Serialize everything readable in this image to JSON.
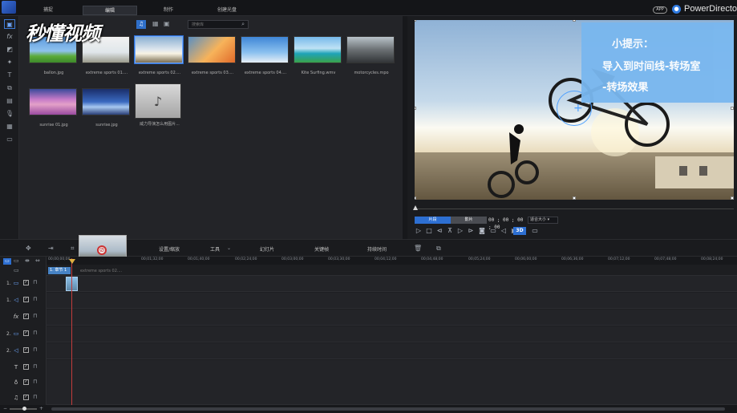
{
  "titlebar": {
    "tabs": [
      {
        "label": "捕捉",
        "active": false
      },
      {
        "label": "编辑",
        "active": true
      },
      {
        "label": "制作",
        "active": false
      },
      {
        "label": "创建光盘",
        "active": false
      }
    ],
    "app_badge": "APP",
    "brand": "PowerDirector"
  },
  "watermark": "秒懂视频",
  "library": {
    "search_placeholder": "搜索库",
    "items": [
      {
        "name": "ballon.jpg",
        "icon": "image"
      },
      {
        "name": "extreme sports 01....",
        "icon": "image"
      },
      {
        "name": "extreme sports 02....",
        "icon": "image",
        "selected": true
      },
      {
        "name": "extreme sports 03....",
        "icon": "image"
      },
      {
        "name": "extreme sports 04....",
        "icon": "image"
      },
      {
        "name": "Kite Surfing.wmv",
        "icon": "video"
      },
      {
        "name": "motorcycles.mpo",
        "icon": "image"
      },
      {
        "name": "sunrise 01.jpg",
        "icon": "image"
      },
      {
        "name": "sunrise.jpg",
        "icon": "image"
      },
      {
        "name": "威力导演怎么用图片...",
        "icon": "music-note-icon"
      }
    ]
  },
  "preview": {
    "tip_lines": [
      "小提示：",
      "导入到时间线-转场室",
      "-转场效果"
    ],
    "mode_clip": "片段",
    "mode_movie": "影片",
    "timecode": "00 ; 00 ; 00 ; 00",
    "zoom": "适合大小",
    "threed": "3D"
  },
  "timeline_toolbar": {
    "fit_crop": "设置/缩放",
    "tools": "工具",
    "slideshow": "幻灯片",
    "keyframe": "关键帧",
    "duration": "持续时间"
  },
  "ruler": {
    "ticks": [
      "00;00;00;00",
      "00;01;32;00",
      "00;01;40;00",
      "00;02;24;00",
      "00;03;00;00",
      "00;03;30;00",
      "00;04;12;00",
      "00;04;48;00",
      "00;05;24;00",
      "00;06;00;00",
      "00;06;36;00",
      "00;07;12;00",
      "00;07;48;00",
      "00;08;24;00"
    ]
  },
  "timeline": {
    "chapter_label": "1. 章节 1",
    "clip_label": "extreme sports 02....",
    "tracks": [
      {
        "num": "1.",
        "icon": "video-track-icon"
      },
      {
        "num": "1.",
        "icon": "audio-track-icon"
      },
      {
        "num": "",
        "icon": "fx-track-icon"
      },
      {
        "num": "2.",
        "icon": "video-track-icon"
      },
      {
        "num": "2.",
        "icon": "audio-track-icon"
      },
      {
        "num": "",
        "icon": "title-track-icon"
      },
      {
        "num": "",
        "icon": "voice-track-icon"
      },
      {
        "num": "",
        "icon": "music-track-icon"
      }
    ]
  },
  "colors": {
    "accent": "#2d6fd2",
    "tip_background": "#79b7ef",
    "playhead": "#c23c3c"
  }
}
